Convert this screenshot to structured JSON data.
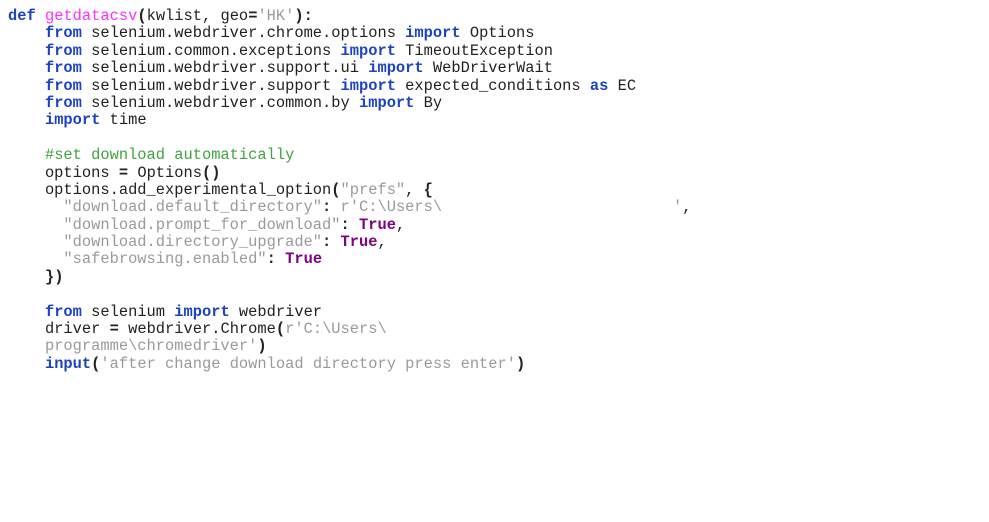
{
  "code": {
    "lines": [
      [
        [
          "kw",
          "def"
        ],
        [
          "tx",
          " "
        ],
        [
          "fn",
          "getdatacsv"
        ],
        [
          "op",
          "("
        ],
        [
          "tx",
          "kwlist, geo"
        ],
        [
          "op",
          "="
        ],
        [
          "str",
          "'HK'"
        ],
        [
          "op",
          "):"
        ]
      ],
      [
        [
          "tx",
          "    "
        ],
        [
          "kw",
          "from"
        ],
        [
          "tx",
          " selenium.webdriver.chrome.options "
        ],
        [
          "kw",
          "import"
        ],
        [
          "tx",
          " Options"
        ]
      ],
      [
        [
          "tx",
          "    "
        ],
        [
          "kw",
          "from"
        ],
        [
          "tx",
          " selenium.common.exceptions "
        ],
        [
          "kw",
          "import"
        ],
        [
          "tx",
          " TimeoutException"
        ]
      ],
      [
        [
          "tx",
          "    "
        ],
        [
          "kw",
          "from"
        ],
        [
          "tx",
          " selenium.webdriver.support.ui "
        ],
        [
          "kw",
          "import"
        ],
        [
          "tx",
          " WebDriverWait"
        ]
      ],
      [
        [
          "tx",
          "    "
        ],
        [
          "kw",
          "from"
        ],
        [
          "tx",
          " selenium.webdriver.support "
        ],
        [
          "kw",
          "import"
        ],
        [
          "tx",
          " expected_conditions "
        ],
        [
          "kw",
          "as"
        ],
        [
          "tx",
          " EC"
        ]
      ],
      [
        [
          "tx",
          "    "
        ],
        [
          "kw",
          "from"
        ],
        [
          "tx",
          " selenium.webdriver.common.by "
        ],
        [
          "kw",
          "import"
        ],
        [
          "tx",
          " By"
        ]
      ],
      [
        [
          "tx",
          "    "
        ],
        [
          "kw",
          "import"
        ],
        [
          "tx",
          " time"
        ]
      ],
      [],
      [
        [
          "tx",
          "    "
        ],
        [
          "cm",
          "#set download automatically"
        ]
      ],
      [
        [
          "tx",
          "    options "
        ],
        [
          "op",
          "="
        ],
        [
          "tx",
          " Options"
        ],
        [
          "op",
          "()"
        ]
      ],
      [
        [
          "tx",
          "    options.add_experimental_option"
        ],
        [
          "op",
          "("
        ],
        [
          "str",
          "\"prefs\""
        ],
        [
          "tx",
          ", "
        ],
        [
          "op",
          "{"
        ]
      ],
      [
        [
          "tx",
          "      "
        ],
        [
          "str",
          "\"download.default_directory\""
        ],
        [
          "op",
          ":"
        ],
        [
          "tx",
          " "
        ],
        [
          "str",
          "r'C:\\Users\\                         '"
        ],
        [
          "tx",
          ","
        ]
      ],
      [
        [
          "tx",
          "      "
        ],
        [
          "str",
          "\"download.prompt_for_download\""
        ],
        [
          "op",
          ":"
        ],
        [
          "tx",
          " "
        ],
        [
          "kw2",
          "True"
        ],
        [
          "tx",
          ","
        ]
      ],
      [
        [
          "tx",
          "      "
        ],
        [
          "str",
          "\"download.directory_upgrade\""
        ],
        [
          "op",
          ":"
        ],
        [
          "tx",
          " "
        ],
        [
          "kw2",
          "True"
        ],
        [
          "tx",
          ","
        ]
      ],
      [
        [
          "tx",
          "      "
        ],
        [
          "str",
          "\"safebrowsing.enabled\""
        ],
        [
          "op",
          ":"
        ],
        [
          "tx",
          " "
        ],
        [
          "kw2",
          "True"
        ]
      ],
      [
        [
          "tx",
          "    "
        ],
        [
          "op",
          "})"
        ]
      ],
      [],
      [
        [
          "tx",
          "    "
        ],
        [
          "kw",
          "from"
        ],
        [
          "tx",
          " selenium "
        ],
        [
          "kw",
          "import"
        ],
        [
          "tx",
          " webdriver"
        ]
      ],
      [
        [
          "tx",
          "    driver "
        ],
        [
          "op",
          "="
        ],
        [
          "tx",
          " webdriver.Chrome"
        ],
        [
          "op",
          "("
        ],
        [
          "str",
          "r'C:\\Users\\"
        ]
      ],
      [
        [
          "tx",
          "    "
        ],
        [
          "str",
          "programme\\chromedriver'"
        ],
        [
          "op",
          ")"
        ]
      ],
      [
        [
          "tx",
          "    "
        ],
        [
          "kw",
          "input"
        ],
        [
          "op",
          "("
        ],
        [
          "str",
          "'after change download directory press enter'"
        ],
        [
          "op",
          ")"
        ]
      ]
    ]
  }
}
